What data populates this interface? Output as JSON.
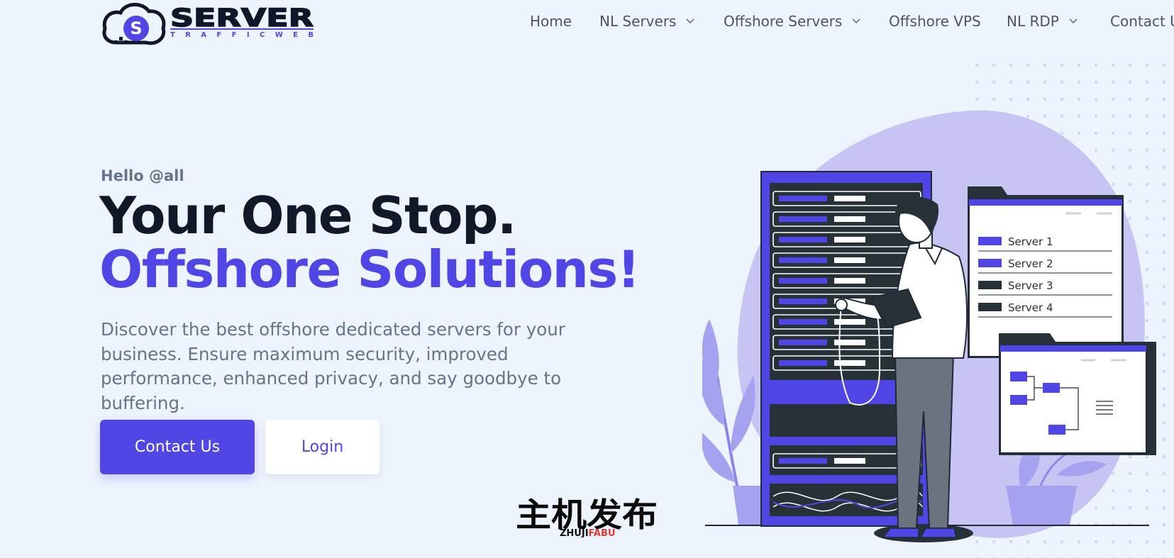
{
  "brand": {
    "logo_text": "SERVER",
    "logo_subtext": "TRAFFICWEB",
    "logo_letter": "S"
  },
  "nav": {
    "items": [
      {
        "label": "Home",
        "has_dropdown": false
      },
      {
        "label": "NL Servers",
        "has_dropdown": true
      },
      {
        "label": "Offshore Servers",
        "has_dropdown": true
      },
      {
        "label": "Offshore VPS",
        "has_dropdown": false
      },
      {
        "label": "NL RDP",
        "has_dropdown": true
      },
      {
        "label": "Contact Us",
        "has_dropdown": false
      }
    ]
  },
  "hero": {
    "greeting": "Hello @all",
    "title_line1": "Your One Stop.",
    "title_line2": "Offshore Solutions!",
    "description": "Discover the best offshore dedicated servers for your business. Ensure maximum security, improved performance, enhanced privacy, and say goodbye to buffering.",
    "primary_button": "Contact Us",
    "secondary_button": "Login"
  },
  "illustration": {
    "server_list": [
      "Server 1",
      "Server 2",
      "Server 3",
      "Server 4"
    ]
  },
  "watermark": {
    "chinese": "主机发布",
    "latin_dark": "ZHUJI",
    "latin_accent": "FABU"
  },
  "colors": {
    "accent": "#4f46e5",
    "background": "#eef4fd",
    "heading": "#111827",
    "body_text": "#64748b",
    "nav_text": "#4b5563",
    "illustration_blob": "#c7c4f4",
    "dark": "#1f2937"
  },
  "icons": {
    "nav_dropdown": "chevron-down-icon",
    "logo_mark": "cloud-logo-icon"
  }
}
